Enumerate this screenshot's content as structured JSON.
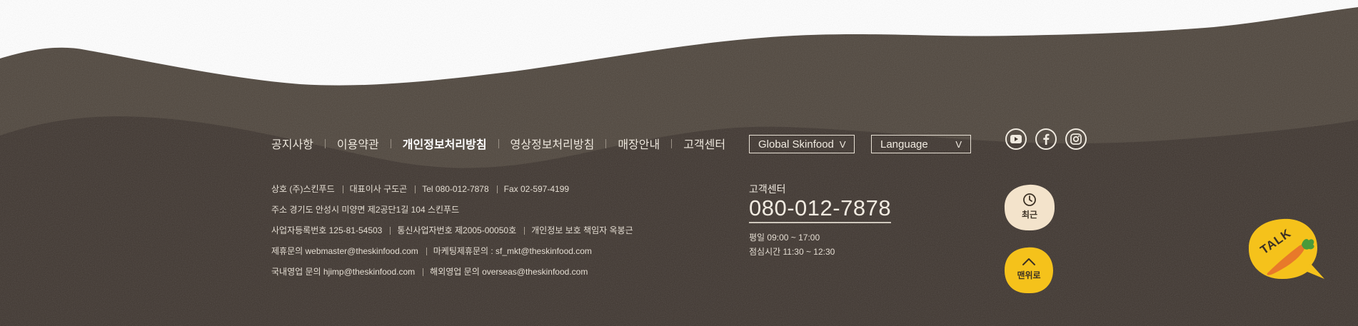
{
  "nav": {
    "items": [
      {
        "label": "공지사항",
        "bold": false
      },
      {
        "label": "이용약관",
        "bold": false
      },
      {
        "label": "개인정보처리방침",
        "bold": true
      },
      {
        "label": "영상정보처리방침",
        "bold": false
      },
      {
        "label": "매장안내",
        "bold": false
      },
      {
        "label": "고객센터",
        "bold": false
      }
    ]
  },
  "selects": {
    "global": {
      "label": "Global Skinfood",
      "chevron": "V"
    },
    "language": {
      "label": "Language",
      "chevron": "V"
    }
  },
  "social": [
    {
      "name": "youtube-icon"
    },
    {
      "name": "facebook-icon"
    },
    {
      "name": "instagram-icon"
    }
  ],
  "company": {
    "rows": [
      [
        "상호 (주)스킨푸드",
        "대표이사 구도곤",
        "Tel 080-012-7878",
        "Fax 02-597-4199"
      ],
      [
        "주소 경기도 안성시 미양면 제2공단1길 104 스킨푸드"
      ],
      [
        "사업자등록번호 125-81-54503",
        "통신사업자번호 제2005-00050호",
        "개인정보 보호 책임자 옥봉근"
      ],
      [
        "제휴문의 webmaster@theskinfood.com",
        "마케팅제휴문의 : sf_mkt@theskinfood.com"
      ],
      [
        "국내영업 문의 hjimp@theskinfood.com",
        "해외영업 문의 overseas@theskinfood.com"
      ]
    ]
  },
  "customer_center": {
    "title": "고객센터",
    "phone": "080-012-7878",
    "hours_weekday": "평일 09:00 ~ 17:00",
    "hours_lunch": "점심시간 11:30 ~ 12:30"
  },
  "floating": {
    "recent_label": "최근",
    "top_label": "맨위로",
    "talk_label": "TALK"
  },
  "colors": {
    "ground": "#4f463d",
    "ground_dark": "#3f3630",
    "recent_bg": "#f3e3cb",
    "top_bg": "#f5c21b",
    "talk_bg": "#f5c21b"
  }
}
